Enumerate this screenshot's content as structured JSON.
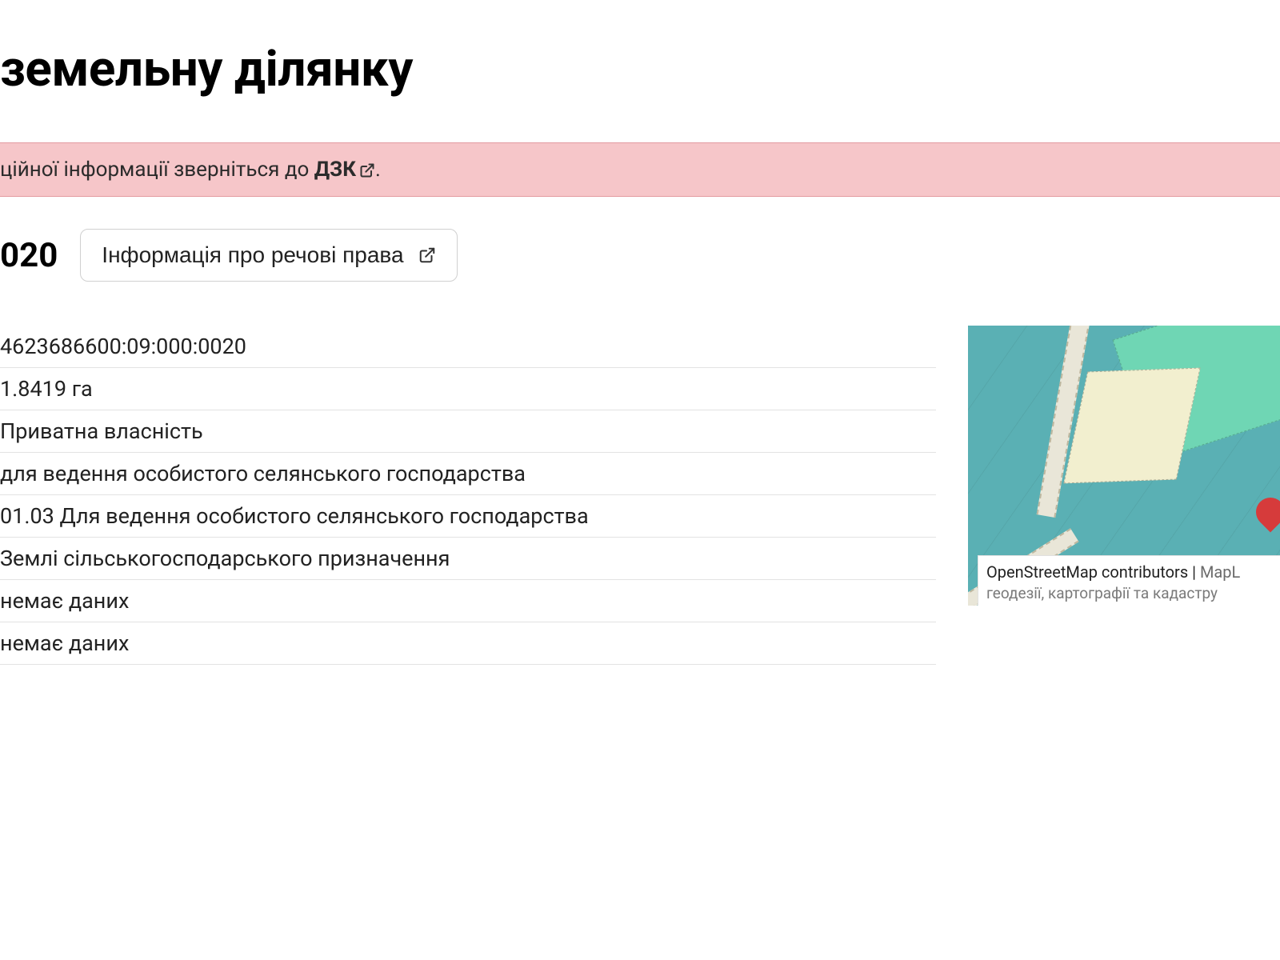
{
  "title": "земельну ділянку",
  "alert": {
    "text_prefix": "ційної інформації зверніться до ",
    "link_label": "ДЗК",
    "text_suffix": "."
  },
  "header": {
    "code_suffix": "020",
    "rights_button_label": "Інформація про речові права"
  },
  "details": [
    "4623686600:09:000:0020",
    "1.8419 га",
    "Приватна власність",
    "для ведення особистого селянського господарства",
    "01.03 Для ведення особистого селянського господарства",
    "Землі сільськогосподарського призначення",
    "немає даних",
    "немає даних"
  ],
  "map": {
    "attribution_line1_a": "OpenStreetMap contributors",
    "attribution_sep": " | ",
    "attribution_line1_b": "MapL",
    "attribution_line2": "геодезії, картографії та кадастру"
  }
}
